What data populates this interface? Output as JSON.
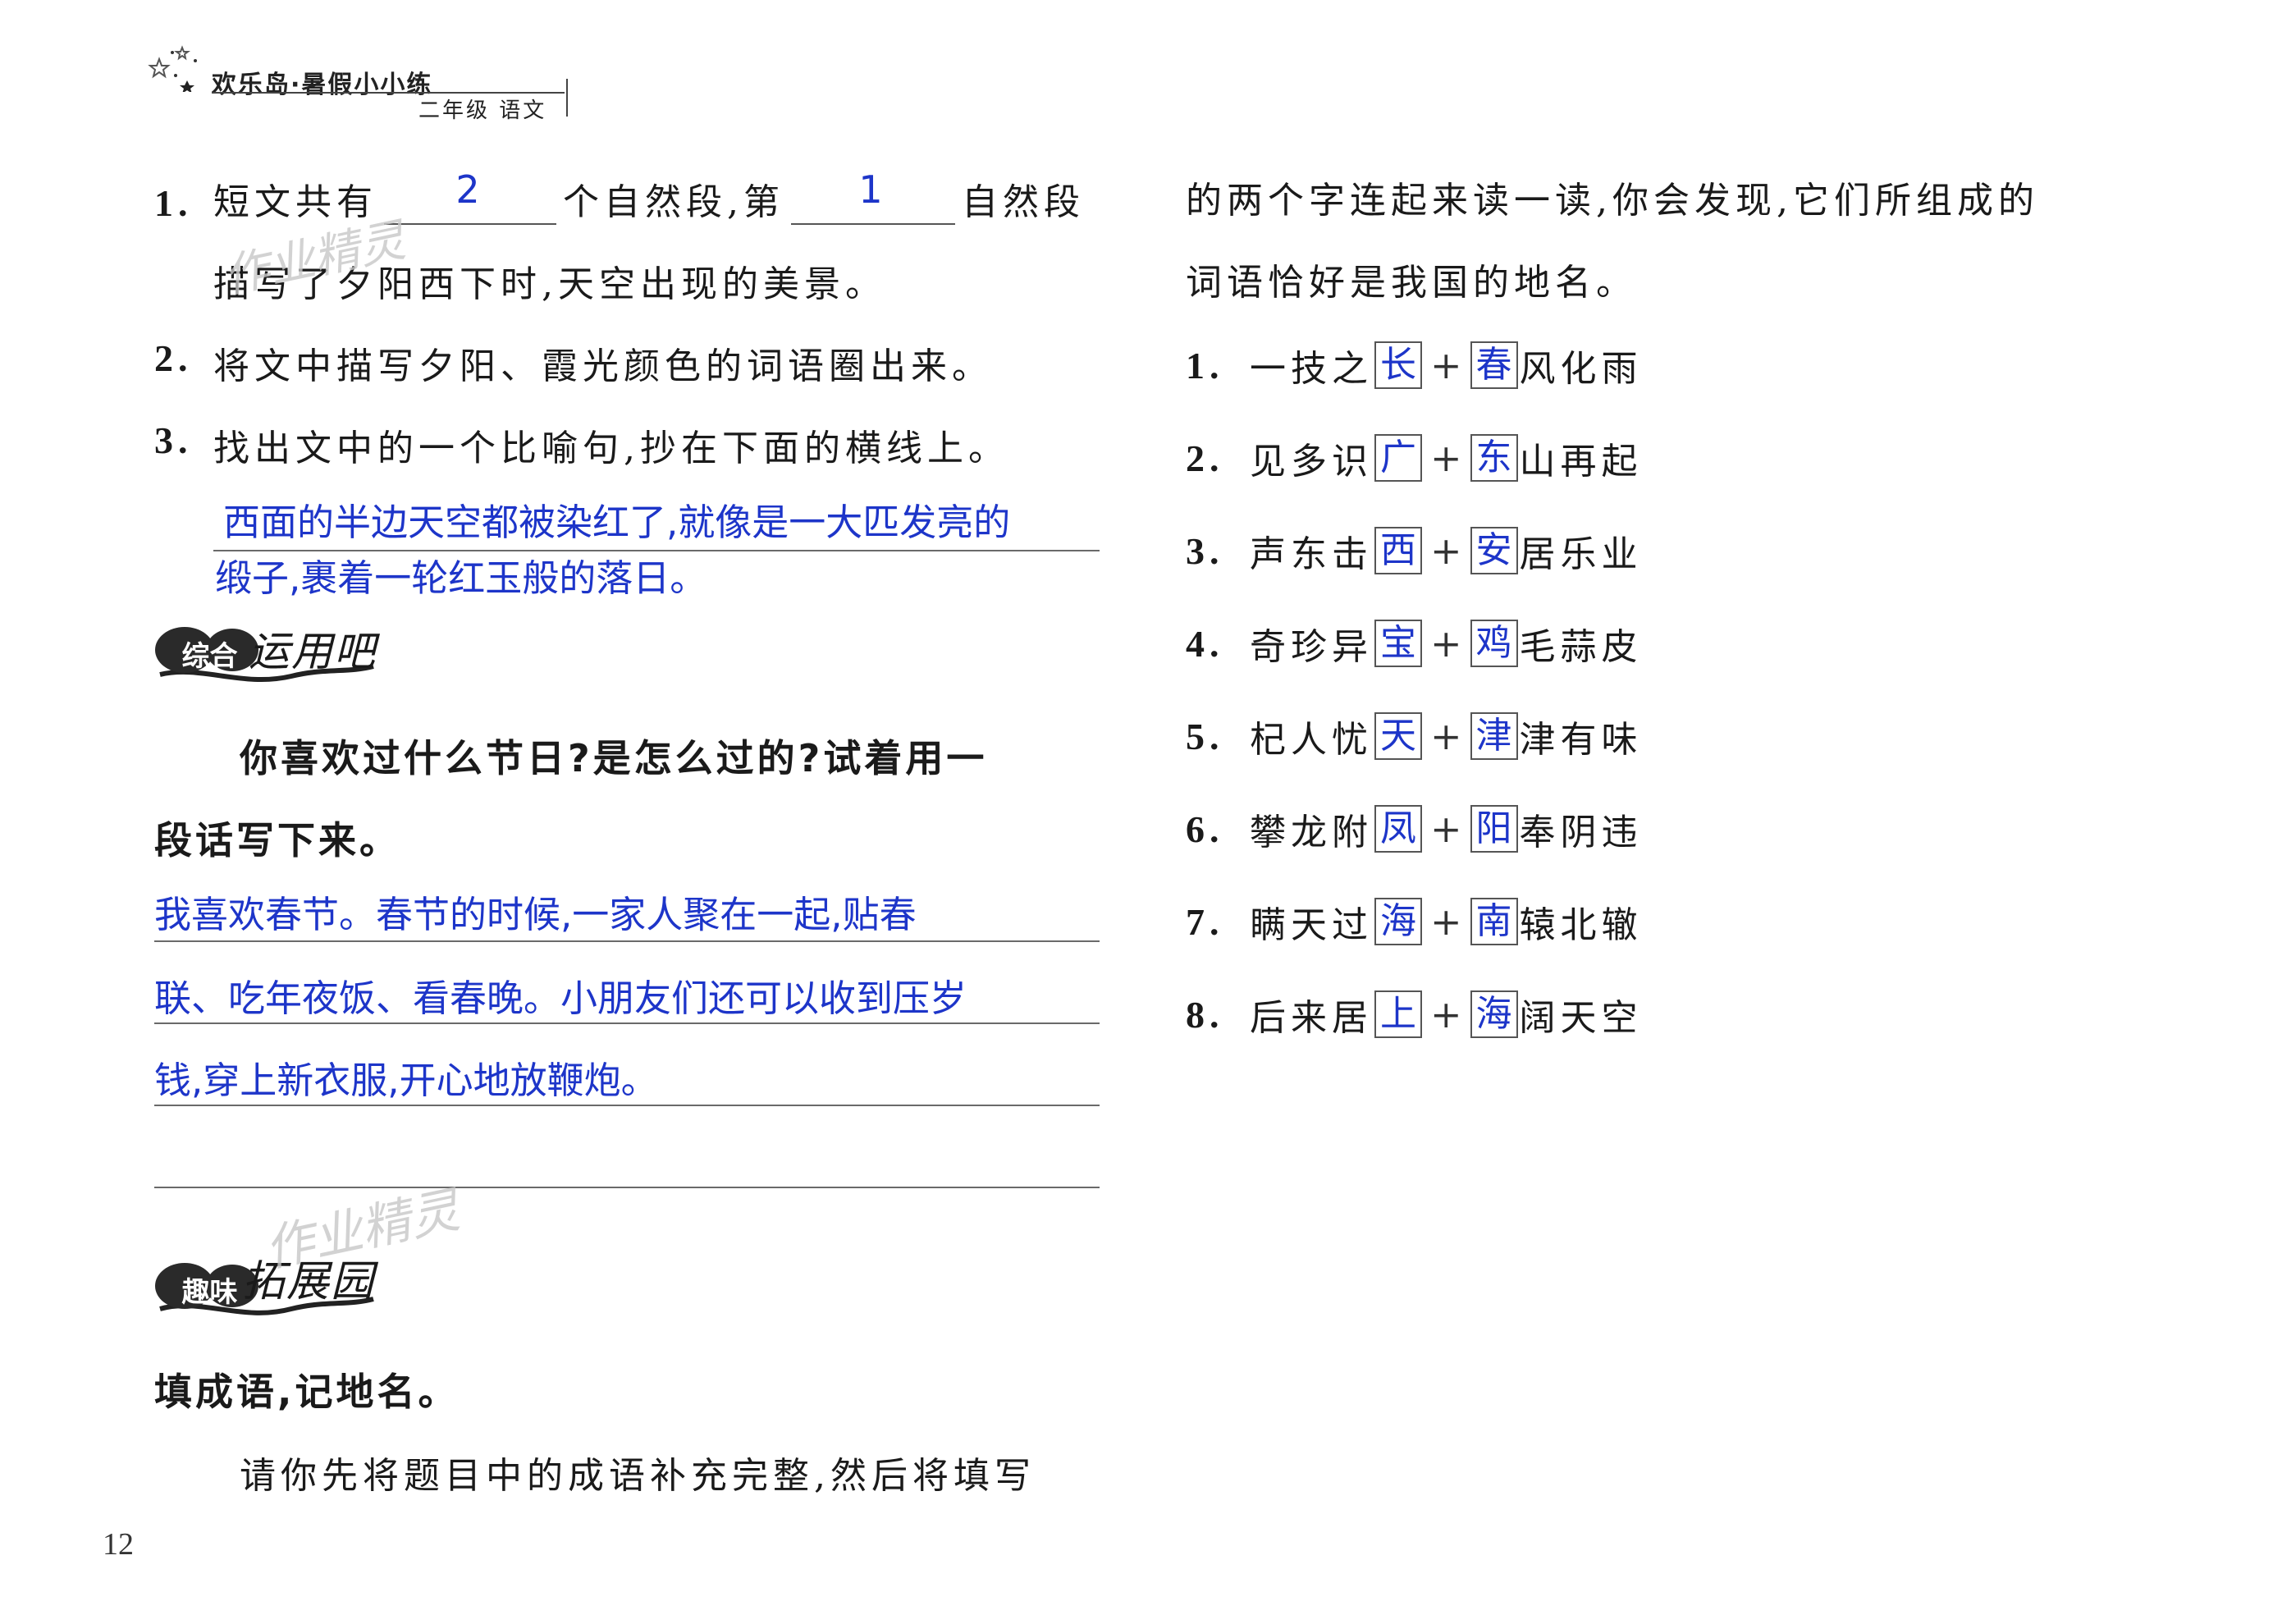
{
  "header": {
    "series": "欢乐岛·暑假小小练",
    "subtitle": "二年级 语文"
  },
  "reading": {
    "q1_num": "1.",
    "q1_part1": "短文共有",
    "q1_answer1": "2",
    "q1_part2": "个自然段,第",
    "q1_answer2": "1",
    "q1_part3": "自然段",
    "q1_line2": "描写了夕阳西下时,天空出现的美景。",
    "q2_num": "2.",
    "q2_text": "将文中描写夕阳、霞光颜色的词语圈出来。",
    "q3_num": "3.",
    "q3_text": "找出文中的一个比喻句,抄在下面的横线上。",
    "q3_answer_line1": "西面的半边天空都被染红了,就像是一大匹发亮的",
    "q3_answer_line2": "缎子,裹着一轮红玉般的落日。"
  },
  "section_apply": {
    "badge": "综合",
    "title": "运用吧",
    "prompt_line1": "你喜欢过什么节日?是怎么过的?试着用一",
    "prompt_line2": "段话写下来。",
    "answer_lines": [
      "我喜欢春节。春节的时候,一家人聚在一起,贴春",
      "联、吃年夜饭、看春晚。小朋友们还可以收到压岁",
      "钱,穿上新衣服,开心地放鞭炮。"
    ]
  },
  "section_extend": {
    "badge": "趣味",
    "title": "拓展园",
    "heading": "填成语,记地名。",
    "intro_line1": "请你先将题目中的成语补充完整,然后将填写",
    "intro_line2": "的两个字连起来读一读,你会发现,它们所组成的",
    "intro_line3": "词语恰好是我国的地名。",
    "items": [
      {
        "num": "1.",
        "prefix": "一技之",
        "box1": "长",
        "box2": "春",
        "suffix": "风化雨"
      },
      {
        "num": "2.",
        "prefix": "见多识",
        "box1": "广",
        "box2": "东",
        "suffix": "山再起"
      },
      {
        "num": "3.",
        "prefix": "声东击",
        "box1": "西",
        "box2": "安",
        "suffix": "居乐业"
      },
      {
        "num": "4.",
        "prefix": "奇珍异",
        "box1": "宝",
        "box2": "鸡",
        "suffix": "毛蒜皮"
      },
      {
        "num": "5.",
        "prefix": "杞人忧",
        "box1": "天",
        "box2": "津",
        "suffix": "津有味"
      },
      {
        "num": "6.",
        "prefix": "攀龙附",
        "box1": "凤",
        "box2": "阳",
        "suffix": "奉阴违"
      },
      {
        "num": "7.",
        "prefix": "瞒天过",
        "box1": "海",
        "box2": "南",
        "suffix": "辕北辙"
      },
      {
        "num": "8.",
        "prefix": "后来居",
        "box1": "上",
        "box2": "海",
        "suffix": "阔天空"
      }
    ],
    "plus_sign": "+"
  },
  "watermark": "作业精灵",
  "page_number": "12",
  "colors": {
    "answer_ink": "#1d35c9",
    "text": "#1a1a1a",
    "rule": "#6a6a6a"
  }
}
